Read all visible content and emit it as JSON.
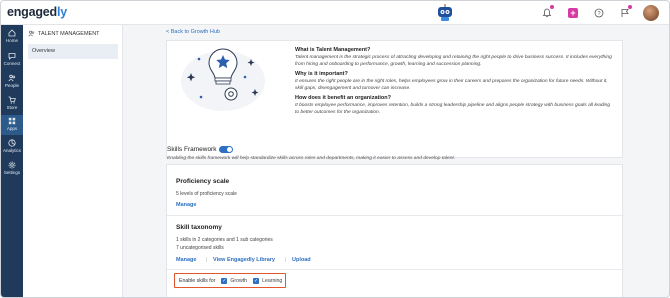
{
  "brand": {
    "logo_main": "engaged",
    "logo_accent": "ly"
  },
  "sidebar": {
    "items": [
      {
        "label": "Home",
        "icon": "home-icon"
      },
      {
        "label": "Connect",
        "icon": "chat-icon"
      },
      {
        "label": "People",
        "icon": "people-icon"
      },
      {
        "label": "Store",
        "icon": "cart-icon"
      },
      {
        "label": "Apps",
        "icon": "apps-icon"
      },
      {
        "label": "Analytics",
        "icon": "analytics-icon"
      },
      {
        "label": "Settings",
        "icon": "gear-icon"
      }
    ]
  },
  "submenu": {
    "title": "TALENT MANAGEMENT",
    "items": [
      "Overview"
    ]
  },
  "main": {
    "back_link": "< Back to Growth Hub",
    "info": {
      "q1": "What is Talent Management?",
      "a1": "Talent management is the strategic process of attracting developing and retaining the right people to drive business success. It includes everything from hiring and onboarding to performance, growth, learning and succession planning.",
      "q2": "Why is it important?",
      "a2": "It ensures the right people are in the right roles, helps employees grow in their careers and prepares the organization for future needs. Without it, skill gaps, disengagement and turnover can increase.",
      "q3": "How does it benefit an organization?",
      "a3": "It boosts employee performance, improves retention, builds a strong leadership pipeline and aligns people strategy with business goals all leading to better outcomes for the organization."
    },
    "skills_framework": {
      "title": "Skills Framework",
      "description": "Enabling the skills framework will help standardize skills across roles and departments, making it easier to assess and develop talent.",
      "enabled": true
    },
    "proficiency": {
      "title": "Proficiency scale",
      "text": "5 levels of proficiency scale",
      "manage": "Manage"
    },
    "taxonomy": {
      "title": "Skill taxonomy",
      "line1": "1 skills in 2 categories and 1 sub categories",
      "line2": "7 uncategorised skills",
      "manage": "Manage",
      "library": "View Engagedly Library",
      "upload": "Upload",
      "separator": "|"
    },
    "enable_skills": {
      "label": "Enable skills for",
      "options": [
        {
          "label": "Growth",
          "checked": true
        },
        {
          "label": "Learning",
          "checked": true
        }
      ]
    }
  },
  "colors": {
    "accent": "#2d6fc2",
    "sidebar": "#1f3a5a",
    "highlight": "#e2562b",
    "badge": "#d63aa3"
  }
}
